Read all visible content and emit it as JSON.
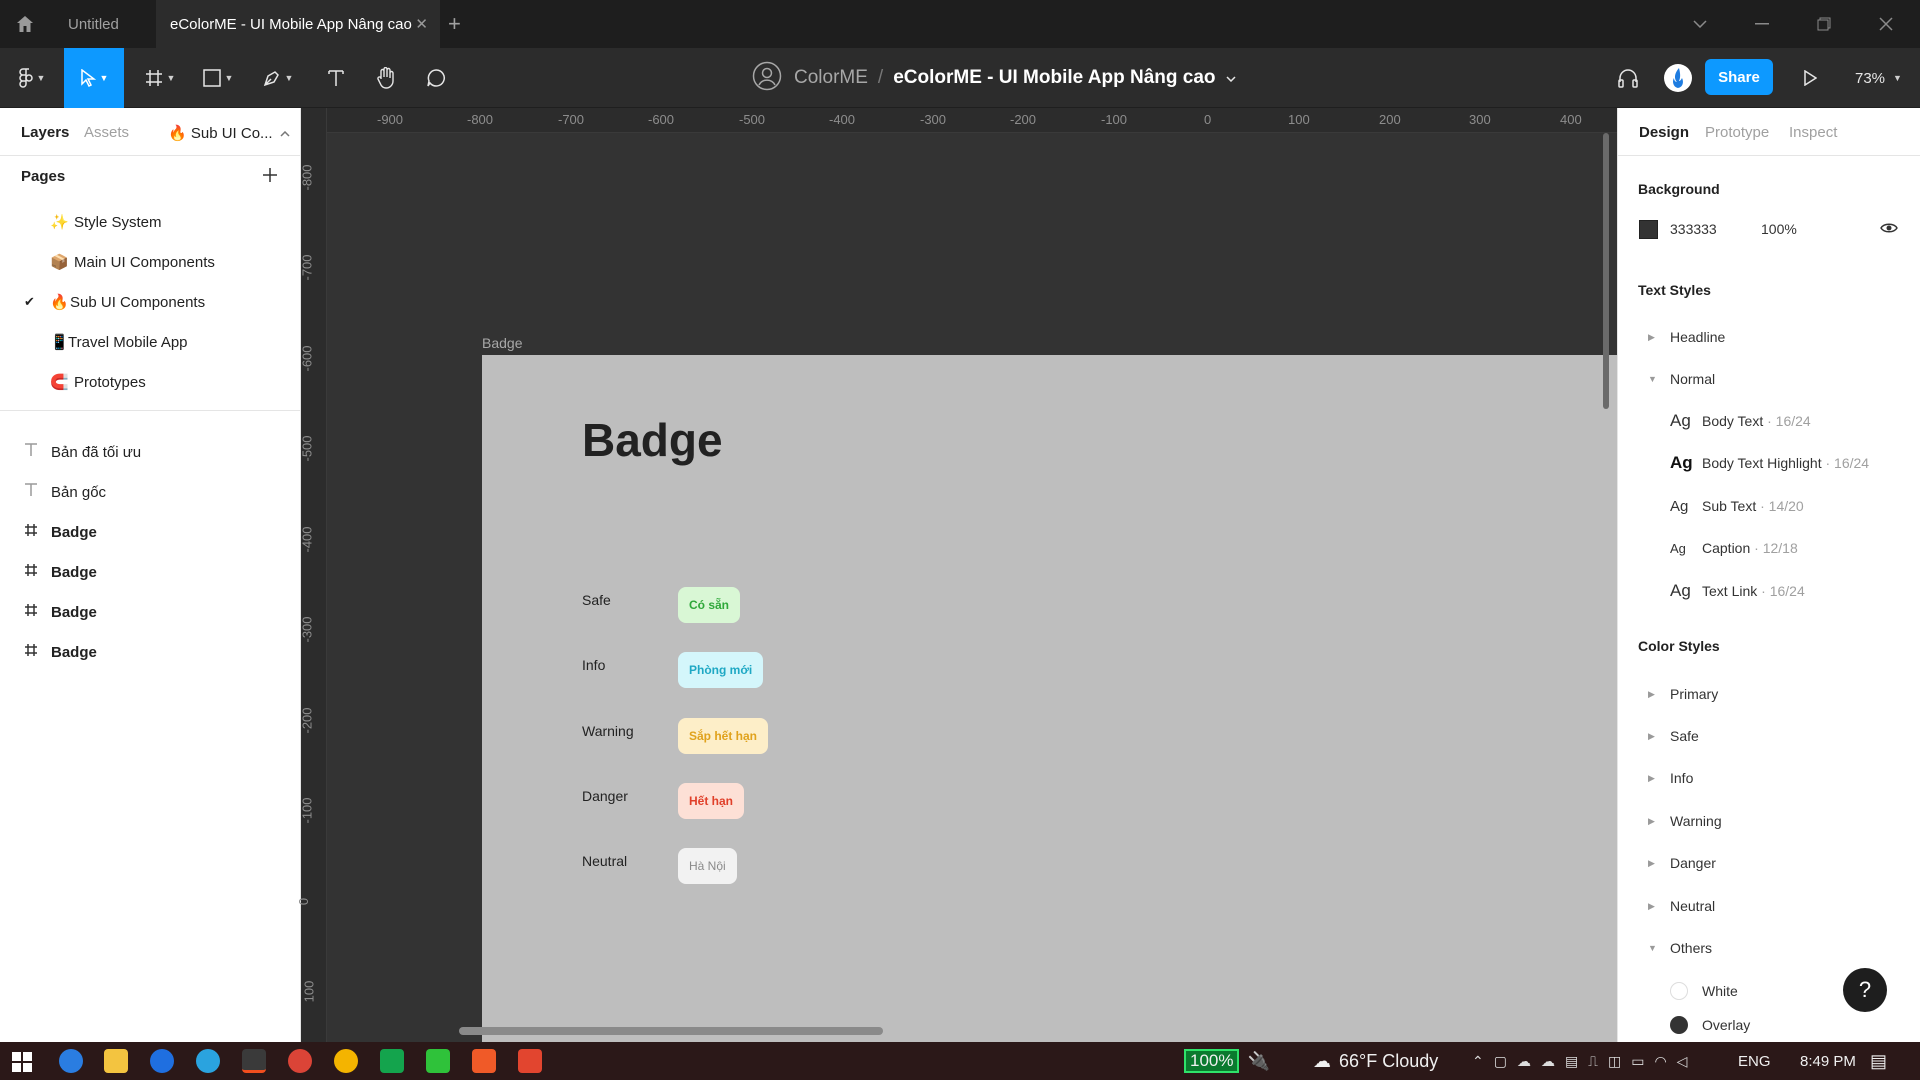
{
  "titlebar": {
    "tabs": [
      {
        "label": "Untitled"
      },
      {
        "label": "eColorME - UI Mobile App Nâng cao"
      }
    ]
  },
  "toolbar": {
    "team": "ColorME",
    "separator": "/",
    "file": "eColorME - UI Mobile App Nâng cao",
    "share_label": "Share",
    "zoom": "73%"
  },
  "left": {
    "tabs": {
      "layers": "Layers",
      "assets": "Assets",
      "page_select": "Sub UI Co..."
    },
    "pages_title": "Pages",
    "pages": [
      {
        "icon": "✨",
        "label": "Style System",
        "selected": false
      },
      {
        "icon": "📦",
        "label": "Main UI Components",
        "selected": false
      },
      {
        "icon": "🔥",
        "label": "Sub UI Components",
        "selected": true
      },
      {
        "icon": "📱",
        "label": "Travel Mobile App",
        "selected": false
      },
      {
        "icon": "🧲",
        "label": "Prototypes",
        "selected": false
      }
    ],
    "layers": [
      {
        "type": "text",
        "label": "Bản đã tối ưu"
      },
      {
        "type": "text",
        "label": "Bản gốc"
      },
      {
        "type": "frame",
        "label": "Badge"
      },
      {
        "type": "frame",
        "label": "Badge"
      },
      {
        "type": "frame",
        "label": "Badge"
      },
      {
        "type": "frame",
        "label": "Badge"
      }
    ]
  },
  "ruler": {
    "top": [
      "-900",
      "-800",
      "-700",
      "-600",
      "-500",
      "-400",
      "-300",
      "-200",
      "-100",
      "0",
      "100",
      "200",
      "300",
      "400"
    ],
    "left": [
      "-800",
      "-700",
      "-600",
      "-500",
      "-400",
      "-300",
      "-200",
      "-100",
      "0",
      "100"
    ]
  },
  "canvas": {
    "background": "#333333",
    "frame_label": "Badge",
    "frame_title": "Badge",
    "badges": [
      {
        "label": "Safe",
        "text": "Có sẵn",
        "bg": "#d9f7d5",
        "fg": "#2fa83a"
      },
      {
        "label": "Info",
        "text": "Phòng mới",
        "bg": "#d4f6fb",
        "fg": "#1fa8c4"
      },
      {
        "label": "Warning",
        "text": "Sắp hết hạn",
        "bg": "#fdeec8",
        "fg": "#e0a21c"
      },
      {
        "label": "Danger",
        "text": "Hết hạn",
        "bg": "#fde0d6",
        "fg": "#e0402a"
      },
      {
        "label": "Neutral",
        "text": "Hà Nội",
        "bg": "#f2f2f2",
        "fg": "#8a8a8a"
      }
    ]
  },
  "right": {
    "tabs": {
      "design": "Design",
      "prototype": "Prototype",
      "inspect": "Inspect"
    },
    "background_title": "Background",
    "background": {
      "swatch": "#333333",
      "hex": "333333",
      "opacity": "100%"
    },
    "text_styles_title": "Text Styles",
    "text_groups": [
      {
        "label": "Headline",
        "expanded": false
      },
      {
        "label": "Normal",
        "expanded": true
      }
    ],
    "text_styles": [
      {
        "ag": "Ag",
        "name": "Body Text",
        "meta": " · 16/24"
      },
      {
        "ag": "Ag",
        "name": "Body Text Highlight",
        "meta": " · 16/24"
      },
      {
        "ag": "Ag",
        "name": "Sub Text",
        "meta": " · 14/20"
      },
      {
        "ag": "Ag",
        "name": "Caption",
        "meta": " · 12/18"
      },
      {
        "ag": "Ag",
        "name": "Text Link",
        "meta": " · 16/24"
      }
    ],
    "color_styles_title": "Color Styles",
    "color_groups": [
      {
        "label": "Primary",
        "expanded": false
      },
      {
        "label": "Safe",
        "expanded": false
      },
      {
        "label": "Info",
        "expanded": false
      },
      {
        "label": "Warning",
        "expanded": false
      },
      {
        "label": "Danger",
        "expanded": false
      },
      {
        "label": "Neutral",
        "expanded": false
      },
      {
        "label": "Others",
        "expanded": true
      }
    ],
    "color_items": [
      {
        "label": "White",
        "color": "#ffffff"
      },
      {
        "label": "Overlay",
        "color": "#333333"
      }
    ],
    "help": "?"
  },
  "taskbar": {
    "battery": "100%",
    "weather": "66°F Cloudy",
    "lang": "ENG",
    "time": "8:49 PM"
  }
}
